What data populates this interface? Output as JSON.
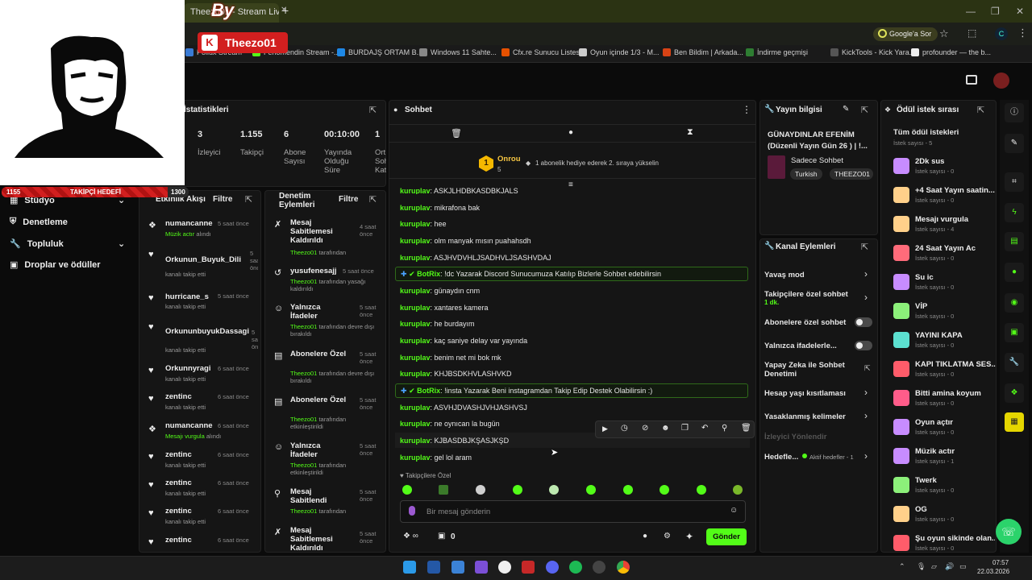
{
  "browser": {
    "tab_title": "Theezo01 - Stream Live",
    "google_sor": "Google'a Sor",
    "profile_initial": "C",
    "bookmarks": [
      {
        "label": "Pollux Stream",
        "color": "#3a7bd5"
      },
      {
        "label": "Fenomendin Stream -...",
        "color": "#53fc18"
      },
      {
        "label": "BURDAJŞ ORTAM B...",
        "color": "#1e88e5"
      },
      {
        "label": "Windows 11 Sahte...",
        "color": "#888888"
      },
      {
        "label": "Cfx.re Sunucu Listesi",
        "color": "#e65100"
      },
      {
        "label": "Oyun içinde 1/3 - M...",
        "color": "#cccccc"
      },
      {
        "label": "Ben Bildim | Arkada...",
        "color": "#d84315"
      },
      {
        "label": "İndirme geçmişi",
        "color": "#2e7d32"
      },
      {
        "label": "KickTools - Kick Yara...",
        "color": "#555555"
      },
      {
        "label": "profounder — the b...",
        "color": "#eeeeee"
      }
    ]
  },
  "overlay": {
    "streamer_name": "Theezo01",
    "by_text": "By",
    "follow_goal_label": "TAKİPÇİ HEDEFİ",
    "follow_goal_current": "1155",
    "follow_goal_target": "1300",
    "follow_goal_progress": 0.888
  },
  "nav": {
    "items": [
      {
        "label": "Stüdyo"
      },
      {
        "label": "Denetleme"
      },
      {
        "label": "Topluluk"
      },
      {
        "label": "Droplar ve ödüller"
      }
    ]
  },
  "stats": {
    "title": "İstatistikleri",
    "values": [
      {
        "value": "3",
        "label": "İzleyici"
      },
      {
        "value": "1.155",
        "label": "Takipçi"
      },
      {
        "value": "6",
        "label": "Abone Sayısı"
      },
      {
        "value": "00:10:00",
        "label": "Yayında Olduğu Süre"
      },
      {
        "value": "1",
        "label": "Ort Soh Kat"
      }
    ]
  },
  "activity": {
    "title": "Etkinlik Akışı",
    "filter": "Filtre",
    "items": [
      {
        "icon": "gift-icon",
        "name": "numancanne",
        "time": "5 saat önce",
        "hl": "Müzik actır",
        "sub": " alındı"
      },
      {
        "icon": "heart-icon",
        "name": "Orkunun_Buyuk_Dili",
        "time": "5 saat önce",
        "hl": "",
        "sub": "kanalı takip etti"
      },
      {
        "icon": "heart-icon",
        "name": "hurricane_s",
        "time": "5 saat önce",
        "hl": "",
        "sub": "kanalı takip etti"
      },
      {
        "icon": "heart-icon",
        "name": "OrkununbuyukDassagi",
        "time": "5 saat önce",
        "hl": "",
        "sub": "kanalı takip etti"
      },
      {
        "icon": "heart-icon",
        "name": "Orkunnyragi",
        "time": "6 saat önce",
        "hl": "",
        "sub": "kanalı takip etti"
      },
      {
        "icon": "heart-icon",
        "name": "zentinc",
        "time": "6 saat önce",
        "hl": "",
        "sub": "kanalı takip etti"
      },
      {
        "icon": "gift-icon",
        "name": "numancanne",
        "time": "6 saat önce",
        "hl": "Mesajı vurgula",
        "sub": " alındı"
      },
      {
        "icon": "heart-icon",
        "name": "zentinc",
        "time": "6 saat önce",
        "hl": "",
        "sub": "kanalı takip etti"
      },
      {
        "icon": "heart-icon",
        "name": "zentinc",
        "time": "6 saat önce",
        "hl": "",
        "sub": "kanalı takip etti"
      },
      {
        "icon": "heart-icon",
        "name": "zentinc",
        "time": "6 saat önce",
        "hl": "",
        "sub": "kanalı takip etti"
      },
      {
        "icon": "heart-icon",
        "name": "zentinc",
        "time": "6 saat önce",
        "hl": "",
        "sub": ""
      }
    ]
  },
  "moderation": {
    "title": "Denetim Eylemleri",
    "filter": "Filtre",
    "items": [
      {
        "name": "Mesaj Sabitlemesi Kaldırıldı",
        "time": "4 saat önce",
        "actor": "Theezo01",
        "sub": " tarafından"
      },
      {
        "name": "yusufenesajj",
        "time": "5 saat önce",
        "actor": "Theezo01",
        "sub": " tarafından yasağı kaldırıldı"
      },
      {
        "name": "Yalnızca İfadeler",
        "time": "5 saat önce",
        "actor": "Theezo01",
        "sub": " tarafından devre dışı bırakıldı"
      },
      {
        "name": "Abonelere Özel",
        "time": "5 saat önce",
        "actor": "Theezo01",
        "sub": " tarafından devre dışı bırakıldı"
      },
      {
        "name": "Abonelere Özel",
        "time": "5 saat önce",
        "actor": "Theezo01",
        "sub": " tarafından etkinleştirildi"
      },
      {
        "name": "Yalnızca İfadeler",
        "time": "5 saat önce",
        "actor": "Theezo01",
        "sub": " tarafından etkinleştirildi"
      },
      {
        "name": "Mesaj Sabitlendi",
        "time": "5 saat önce",
        "actor": "Theezo01",
        "sub": " tarafından"
      },
      {
        "name": "Mesaj Sabitlemesi Kaldırıldı",
        "time": "5 saat önce",
        "actor": "",
        "sub": ""
      }
    ]
  },
  "chat": {
    "title": "Sohbet",
    "top_user": "Onrou",
    "top_rank": "1",
    "top_count": "5",
    "gift_text": "1 abonelik hediye ederek 2. sıraya yükselin",
    "lines": [
      {
        "user": "kuruplav",
        "text": "ASKJLHDBKASDBKJALS",
        "bot": false
      },
      {
        "user": "kuruplav",
        "text": "mikrafona bak",
        "bot": false
      },
      {
        "user": "kuruplav",
        "text": "hee",
        "bot": false
      },
      {
        "user": "kuruplav",
        "text": "olm manyak mısın puahahsdh",
        "bot": false
      },
      {
        "user": "kuruplav",
        "text": "ASJHVDVHLJSADHVLJSASHVDAJ",
        "bot": false
      },
      {
        "user": "BotRix",
        "text": "!dc Yazarak Discord Sunucumuza Katılıp Bizlerle Sohbet edebilirsin",
        "bot": true
      },
      {
        "user": "kuruplav",
        "text": "günaydın cnm",
        "bot": false
      },
      {
        "user": "kuruplav",
        "text": "xantares kamera",
        "bot": false
      },
      {
        "user": "kuruplav",
        "text": "he burdayım",
        "bot": false
      },
      {
        "user": "kuruplav",
        "text": "kaç saniye delay var yayında",
        "bot": false
      },
      {
        "user": "kuruplav",
        "text": "benim net mi bok mk",
        "bot": false
      },
      {
        "user": "kuruplav",
        "text": "KHJBSDKHVLASHVKD",
        "bot": false
      },
      {
        "user": "BotRix",
        "text": "!insta Yazarak Beni instagramdan Takip Edip Destek Olabilirsin :)",
        "bot": true
      },
      {
        "user": "kuruplav",
        "text": "ASVHJDVASHJVHJASHVSJ",
        "bot": false
      },
      {
        "user": "kuruplav",
        "text": "ne oynıcan la bugün",
        "bot": false
      },
      {
        "user": "kuruplav",
        "text": "KJBASDBJKŞASJKŞD",
        "bot": false
      },
      {
        "user": "kuruplav",
        "text": "gel lol aram",
        "bot": false
      }
    ],
    "followers_only": "Takipçilere Özel",
    "input_placeholder": "Bir mesaj gönderin",
    "points": "0",
    "send": "Gönder"
  },
  "stream_info": {
    "title": "Yayın bilgisi",
    "stream_title": "GÜNAYDINLAR EFENİM (Düzenli Yayın Gün 26 ) | !...",
    "category": "Sadece Sohbet",
    "tags": [
      "Turkish",
      "THEEZO01"
    ]
  },
  "channel_actions": {
    "title": "Kanal Eylemleri",
    "items": [
      {
        "label": "Yavaş mod",
        "sub": "",
        "type": "chevron"
      },
      {
        "label": "Takipçilere özel sohbet",
        "sub": "1 dk.",
        "type": "chevron"
      },
      {
        "label": "Abonelere özel sohbet",
        "sub": "",
        "type": "toggle"
      },
      {
        "label": "Yalnızca ifadelerle...",
        "sub": "",
        "type": "toggle"
      },
      {
        "label": "Yapay Zeka ile Sohbet Denetimi",
        "sub": "",
        "type": "external"
      },
      {
        "label": "Hesap yaşı kısıtlaması",
        "sub": "",
        "type": "chevron"
      },
      {
        "label": "Yasaklanmış kelimeler",
        "sub": "",
        "type": "chevron"
      },
      {
        "label": "İzleyici Yönlendir",
        "sub": "",
        "type": "disabled"
      },
      {
        "label": "Hedefle...",
        "sub": "Aktif hedefler - 1",
        "type": "goal"
      }
    ]
  },
  "rewards": {
    "title": "Ödül istek sırası",
    "all_label": "Tüm ödül istekleri",
    "all_count": "İstek sayısı - 5",
    "items": [
      {
        "name": "2Dk sus",
        "count": "İstek sayısı - 0",
        "color": "#c78cff"
      },
      {
        "name": "+4 Saat Yayın saatin...",
        "count": "İstek sayısı - 0",
        "color": "#ffd08a"
      },
      {
        "name": "Mesajı vurgula",
        "count": "İstek sayısı - 4",
        "color": "#ffd08a"
      },
      {
        "name": "24 Saat Yayın Ac",
        "count": "İstek sayısı - 0",
        "color": "#ff6b7a"
      },
      {
        "name": "Su ic",
        "count": "İstek sayısı - 0",
        "color": "#c78cff"
      },
      {
        "name": "VİP",
        "count": "İstek sayısı - 0",
        "color": "#8cf07a"
      },
      {
        "name": "YAYINI KAPA",
        "count": "İstek sayısı - 0",
        "color": "#5ce0d0"
      },
      {
        "name": "KAPI TIKLATMA SES...",
        "count": "İstek sayısı - 0",
        "color": "#ff5c6a"
      },
      {
        "name": "Bitti amina koyum",
        "count": "İstek sayısı - 0",
        "color": "#ff5c8a"
      },
      {
        "name": "Oyun açtır",
        "count": "İstek sayısı - 0",
        "color": "#c78cff"
      },
      {
        "name": "Müzik actır",
        "count": "İstek sayısı - 1",
        "color": "#c78cff"
      },
      {
        "name": "Twerk",
        "count": "İstek sayısı - 0",
        "color": "#8cf07a"
      },
      {
        "name": "OG",
        "count": "İstek sayısı - 0",
        "color": "#ffd08a"
      },
      {
        "name": "Şu oyun sikinde olan...",
        "count": "İstek sayısı - 0",
        "color": "#ff5c6a"
      }
    ]
  },
  "taskbar": {
    "time": "07:57",
    "date": "22.03.2026"
  }
}
